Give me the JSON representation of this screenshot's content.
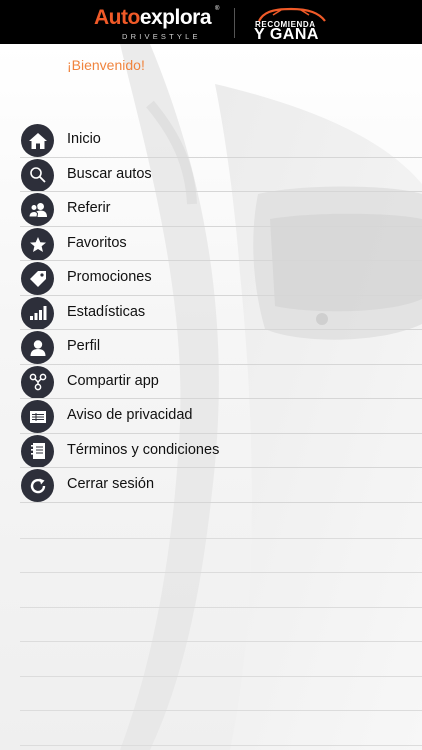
{
  "header": {
    "brand_first": "Auto",
    "brand_second": "explora",
    "brand_registered": "®",
    "brand_tagline": "DRIVESTYLE",
    "promo_line1": "RECOMIENDA",
    "promo_line2": "Y GANA",
    "colors": {
      "background": "#000000",
      "brand_accent": "#f05a28"
    }
  },
  "welcome": "¡Bienvenido!",
  "menu": {
    "items": [
      {
        "label": "Inicio",
        "icon": "home-icon"
      },
      {
        "label": "Buscar autos",
        "icon": "search-icon"
      },
      {
        "label": "Referir",
        "icon": "users-icon"
      },
      {
        "label": "Favoritos",
        "icon": "star-icon"
      },
      {
        "label": "Promociones",
        "icon": "tag-icon"
      },
      {
        "label": "Estadísticas",
        "icon": "bar-chart-icon"
      },
      {
        "label": "Perfil",
        "icon": "user-icon"
      },
      {
        "label": "Compartir app",
        "icon": "share-icon"
      },
      {
        "label": "Aviso de privacidad",
        "icon": "document-icon"
      },
      {
        "label": "Términos y condiciones",
        "icon": "notebook-icon"
      },
      {
        "label": "Cerrar sesión",
        "icon": "refresh-icon"
      }
    ]
  },
  "colors": {
    "welcome_text": "#f0843e",
    "icon_circle": "#2d2f3a"
  }
}
